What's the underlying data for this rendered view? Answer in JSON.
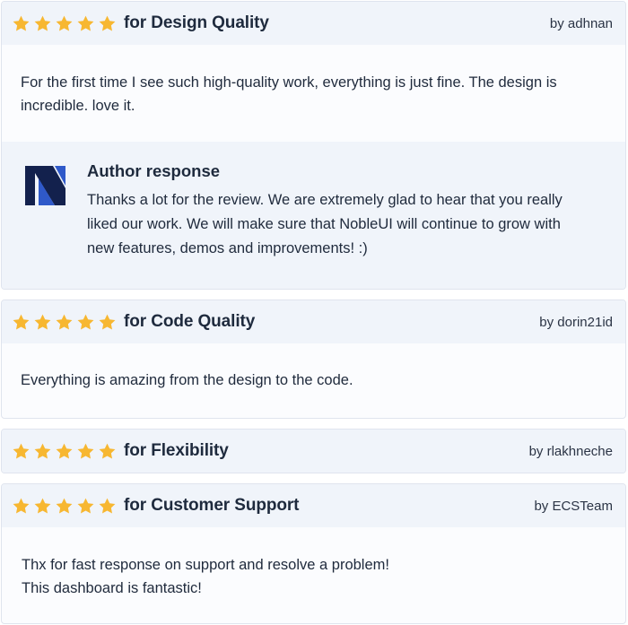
{
  "reviews": [
    {
      "title": "for Design Quality",
      "author": "by adhnan",
      "body": "For the first time I see such high-quality work, everything is just fine. The design is incredible. love it.",
      "response": {
        "title": "Author response",
        "text": "Thanks a lot for the review. We are extremely glad to hear that you really liked our work. We will make sure that NobleUI will continue to grow with new features, demos and improvements! :)"
      }
    },
    {
      "title": "for Code Quality",
      "author": "by dorin21id",
      "body": "Everything is amazing from the design to the code."
    },
    {
      "title": "for Flexibility",
      "author": "by rlakhneche"
    },
    {
      "title": "for Customer Support",
      "author": "by ECSTeam",
      "body_lines": [
        "Thx for fast response on support and resolve a problem!",
        "This dashboard is fantastic!"
      ]
    }
  ],
  "rating": 5,
  "colors": {
    "star": "#f7b731",
    "header_bg": "#f0f4fa",
    "logo_dark": "#13214d",
    "logo_blue": "#2f59c9"
  }
}
